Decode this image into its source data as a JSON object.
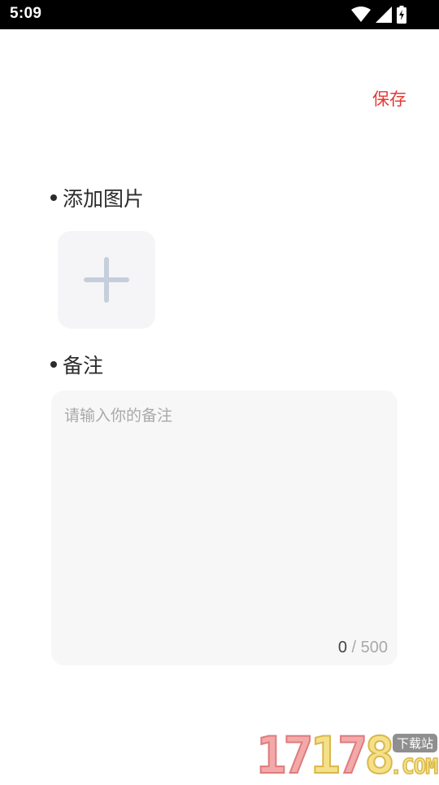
{
  "status_bar": {
    "time": "5:09",
    "icons": [
      "wifi-icon",
      "signal-icon",
      "battery-charging-icon"
    ]
  },
  "header": {
    "save_label": "保存",
    "save_color": "#e53935"
  },
  "images_section": {
    "label": "添加图片",
    "add_icon": "plus-icon"
  },
  "notes_section": {
    "label": "备注",
    "placeholder": "请输入你的备注",
    "value": "",
    "char_count": "0",
    "separator": "/",
    "max_chars": "500"
  },
  "watermark": {
    "digits_red": "17",
    "digits_yellow_1": "1",
    "digits_red_2": "7",
    "digits_yellow_2": "8",
    "badge": "下载站",
    "suffix": ".COM"
  }
}
